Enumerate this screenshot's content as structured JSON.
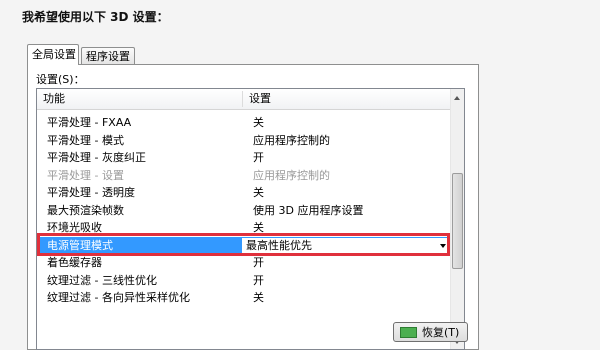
{
  "heading": "我希望使用以下 3D 设置：",
  "tabs": [
    {
      "label": "全局设置",
      "active": true
    },
    {
      "label": "程序设置",
      "active": false
    }
  ],
  "settings_label": "设置(S)：",
  "columns": {
    "feature": "功能",
    "setting": "设置"
  },
  "rows": [
    {
      "feature": "平滑处理 - FXAA",
      "value": "关",
      "state": "normal"
    },
    {
      "feature": "平滑处理 - 模式",
      "value": "应用程序控制的",
      "state": "normal"
    },
    {
      "feature": "平滑处理 - 灰度纠正",
      "value": "开",
      "state": "normal"
    },
    {
      "feature": "平滑处理 - 设置",
      "value": "应用程序控制的",
      "state": "disabled"
    },
    {
      "feature": "平滑处理 - 透明度",
      "value": "关",
      "state": "normal"
    },
    {
      "feature": "最大预渲染帧数",
      "value": "使用 3D 应用程序设置",
      "state": "normal"
    },
    {
      "feature": "环境光吸收",
      "value": "关",
      "state": "normal"
    },
    {
      "feature": "电源管理模式",
      "value": "最高性能优先",
      "state": "selected"
    },
    {
      "feature": "着色缓存器",
      "value": "开",
      "state": "normal"
    },
    {
      "feature": "纹理过滤 - 三线性优化",
      "value": "开",
      "state": "normal"
    },
    {
      "feature": "纹理过滤 - 各向异性采样优化",
      "value": "关",
      "state": "normal"
    }
  ],
  "restore_button": {
    "label": "恢复(T)",
    "icon": "nvidia-icon"
  },
  "colors": {
    "selection": "#3399ff",
    "highlight_frame": "#e0303c"
  }
}
